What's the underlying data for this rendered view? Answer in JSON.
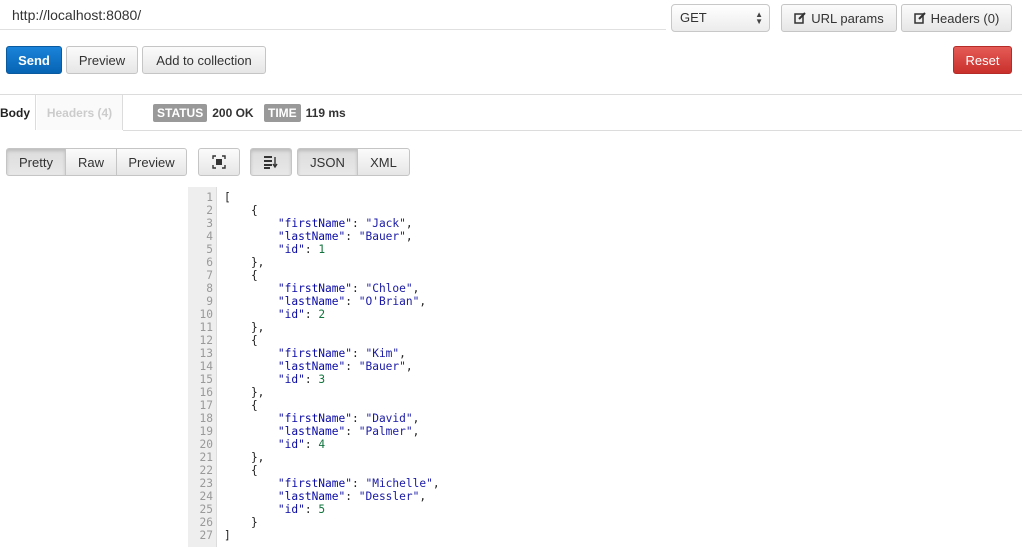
{
  "request": {
    "url": "http://localhost:8080/",
    "method": "GET",
    "url_params_label": "URL params",
    "headers_label": "Headers (0)"
  },
  "actions": {
    "send": "Send",
    "preview": "Preview",
    "add_to_collection": "Add to collection",
    "reset": "Reset"
  },
  "response": {
    "tabs": {
      "body": "Body",
      "headers": "Headers (4)"
    },
    "status_label": "STATUS",
    "status_value": "200 OK",
    "time_label": "TIME",
    "time_value": "119 ms",
    "view_modes": [
      "Pretty",
      "Raw",
      "Preview"
    ],
    "formats": [
      "JSON",
      "XML"
    ],
    "active_view": "Pretty",
    "active_format": "JSON"
  },
  "body": [
    {
      "firstName": "Jack",
      "lastName": "Bauer",
      "id": 1
    },
    {
      "firstName": "Chloe",
      "lastName": "O'Brian",
      "id": 2
    },
    {
      "firstName": "Kim",
      "lastName": "Bauer",
      "id": 3
    },
    {
      "firstName": "David",
      "lastName": "Palmer",
      "id": 4
    },
    {
      "firstName": "Michelle",
      "lastName": "Dessler",
      "id": 5
    }
  ],
  "colors": {
    "send": "#0764b4",
    "reset": "#c9302c",
    "badge": "#999999",
    "json_key": "#0a0aa5",
    "json_number": "#11743d"
  }
}
